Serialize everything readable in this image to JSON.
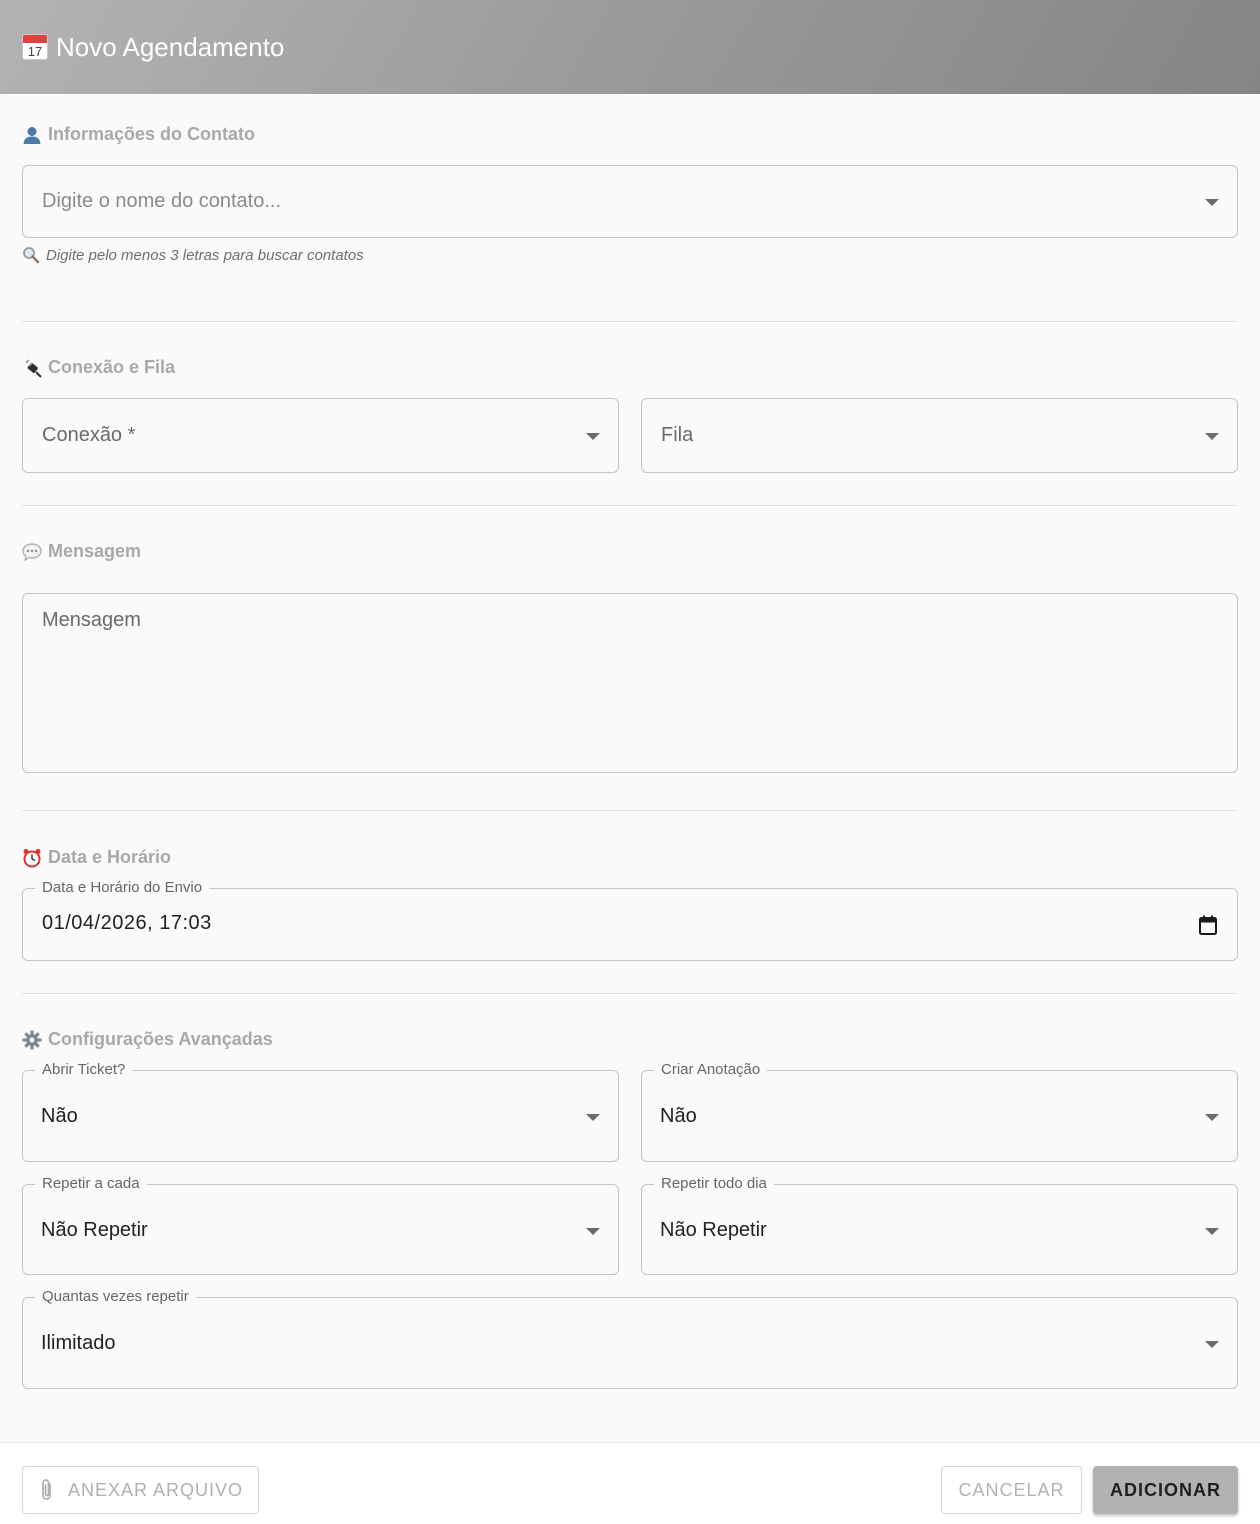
{
  "header": {
    "title": "Novo Agendamento",
    "icon": "calendar-icon",
    "icon_day": "17"
  },
  "contact": {
    "section_title": "Informações do Contato",
    "placeholder": "Digite o nome do contato...",
    "hint": "Digite pelo menos 3 letras para buscar contatos"
  },
  "connection": {
    "section_title": "Conexão e Fila",
    "connection_label": "Conexão *",
    "queue_label": "Fila"
  },
  "message": {
    "section_title": "Mensagem",
    "placeholder": "Mensagem"
  },
  "datetime": {
    "section_title": "Data e Horário",
    "label": "Data e Horário do Envio",
    "value": "01/04/2026, 17:03"
  },
  "advanced": {
    "section_title": "Configurações Avançadas",
    "open_ticket": {
      "label": "Abrir Ticket?",
      "value": "Não"
    },
    "create_note": {
      "label": "Criar Anotação",
      "value": "Não"
    },
    "repeat_every": {
      "label": "Repetir a cada",
      "value": "Não Repetir"
    },
    "repeat_daily": {
      "label": "Repetir todo dia",
      "value": "Não Repetir"
    },
    "repeat_times": {
      "label": "Quantas vezes repetir",
      "value": "Ilimitado"
    }
  },
  "footer": {
    "attach_label": "ANEXAR ARQUIVO",
    "cancel_label": "CANCELAR",
    "add_label": "ADICIONAR"
  },
  "colors": {
    "header_start": "#b3b3b3",
    "header_end": "#858585",
    "add_button": "#b2b2b2"
  }
}
